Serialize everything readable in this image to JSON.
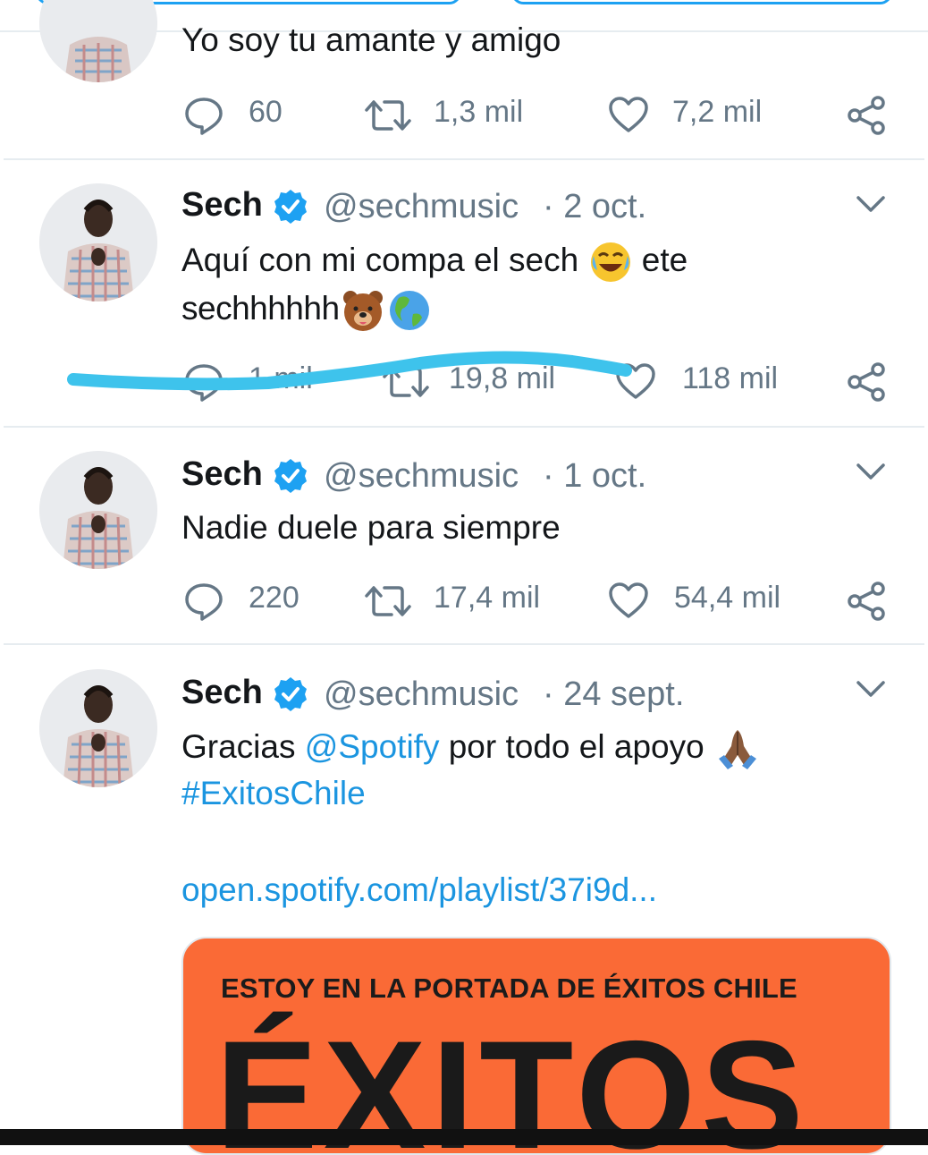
{
  "tweets": [
    {
      "text_lines": [
        "Yo soy tu amante y amigo"
      ],
      "stats": {
        "replies": "60",
        "retweets": "1,3 mil",
        "likes": "7,2 mil"
      }
    },
    {
      "name": "Sech",
      "handle": "@sechmusic",
      "date": "· 2 oct.",
      "text_line1": "Aquí con mi compa el sech",
      "text_line1_tail": "ete",
      "text_line2": "sechhhhhh",
      "stats": {
        "replies": "1 mil",
        "retweets": "19,8 mil",
        "likes": "118 mil"
      }
    },
    {
      "name": "Sech",
      "handle": "@sechmusic",
      "date": "· 1 oct.",
      "text_line1": "Nadie duele para siempre",
      "stats": {
        "replies": "220",
        "retweets": "17,4 mil",
        "likes": "54,4 mil"
      }
    },
    {
      "name": "Sech",
      "handle": "@sechmusic",
      "date": "· 24 sept.",
      "text_prefix": "Gracias",
      "mention": "@Spotify",
      "text_suffix": "por todo el apoyo",
      "hashtag": "#ExitosChile",
      "url": "open.spotify.com/playlist/37i9d...",
      "card": {
        "subtitle": "ESTOY EN LA PORTADA DE ÉXITOS CHILE",
        "title": "ÉXITOS"
      }
    }
  ],
  "colors": {
    "link": "#1b95e0",
    "verified": "#1da1f2",
    "card_bg": "#fa6a36",
    "muted": "#657786",
    "scribble": "#3ec3ec"
  },
  "icons": [
    "reply-icon",
    "retweet-icon",
    "like-icon",
    "share-icon",
    "verified-badge-icon",
    "chevron-down-icon"
  ]
}
